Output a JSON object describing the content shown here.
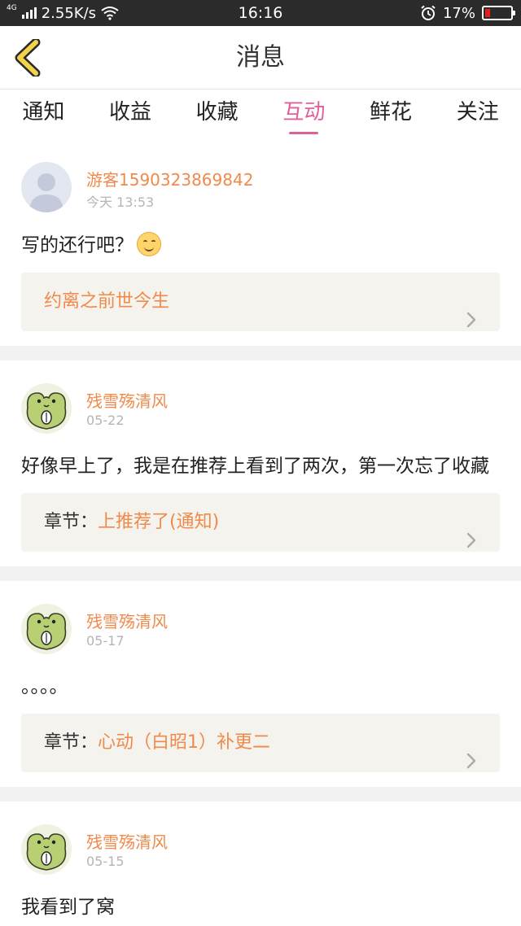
{
  "status_bar": {
    "network_type": "4G",
    "speed": "2.55K/s",
    "time": "16:16",
    "battery_percent": "17%",
    "battery_level": 0.17,
    "icons": [
      "signal-icon",
      "wifi-icon",
      "alarm-icon",
      "battery-icon"
    ]
  },
  "header": {
    "title": "消息",
    "back_icon": "chevron-left-icon",
    "accent_color": "#f2d34a"
  },
  "tabs": [
    {
      "label": "通知",
      "active": false
    },
    {
      "label": "收益",
      "active": false
    },
    {
      "label": "收藏",
      "active": false
    },
    {
      "label": "互动",
      "active": true
    },
    {
      "label": "鲜花",
      "active": false
    },
    {
      "label": "关注",
      "active": false
    }
  ],
  "colors": {
    "active_tab": "#e0609a",
    "username": "#f08a4b",
    "timestamp": "#b5b5b5",
    "ref_bg": "#f4f3ee"
  },
  "messages": [
    {
      "username": "游客1590323869842",
      "time": "今天 13:53",
      "avatar": "default-avatar",
      "content": "写的还行吧？",
      "has_emoji": true,
      "ref_prefix": "",
      "ref_title": "约离之前世今生"
    },
    {
      "username": "残雪殇清风",
      "time": "05-22",
      "avatar": "frog-avatar",
      "content": "好像早上了，我是在推荐上看到了两次，第一次忘了收藏",
      "has_emoji": false,
      "ref_prefix": "章节：",
      "ref_title": "上推荐了(通知)"
    },
    {
      "username": "残雪殇清风",
      "time": "05-17",
      "avatar": "frog-avatar",
      "content": "。。。。",
      "has_emoji": false,
      "ref_prefix": "章节：",
      "ref_title": "心动（白昭1）补更二"
    },
    {
      "username": "残雪殇清风",
      "time": "05-15",
      "avatar": "frog-avatar",
      "content": "我看到了窝",
      "has_emoji": false,
      "ref_prefix": "",
      "ref_title": ""
    }
  ]
}
